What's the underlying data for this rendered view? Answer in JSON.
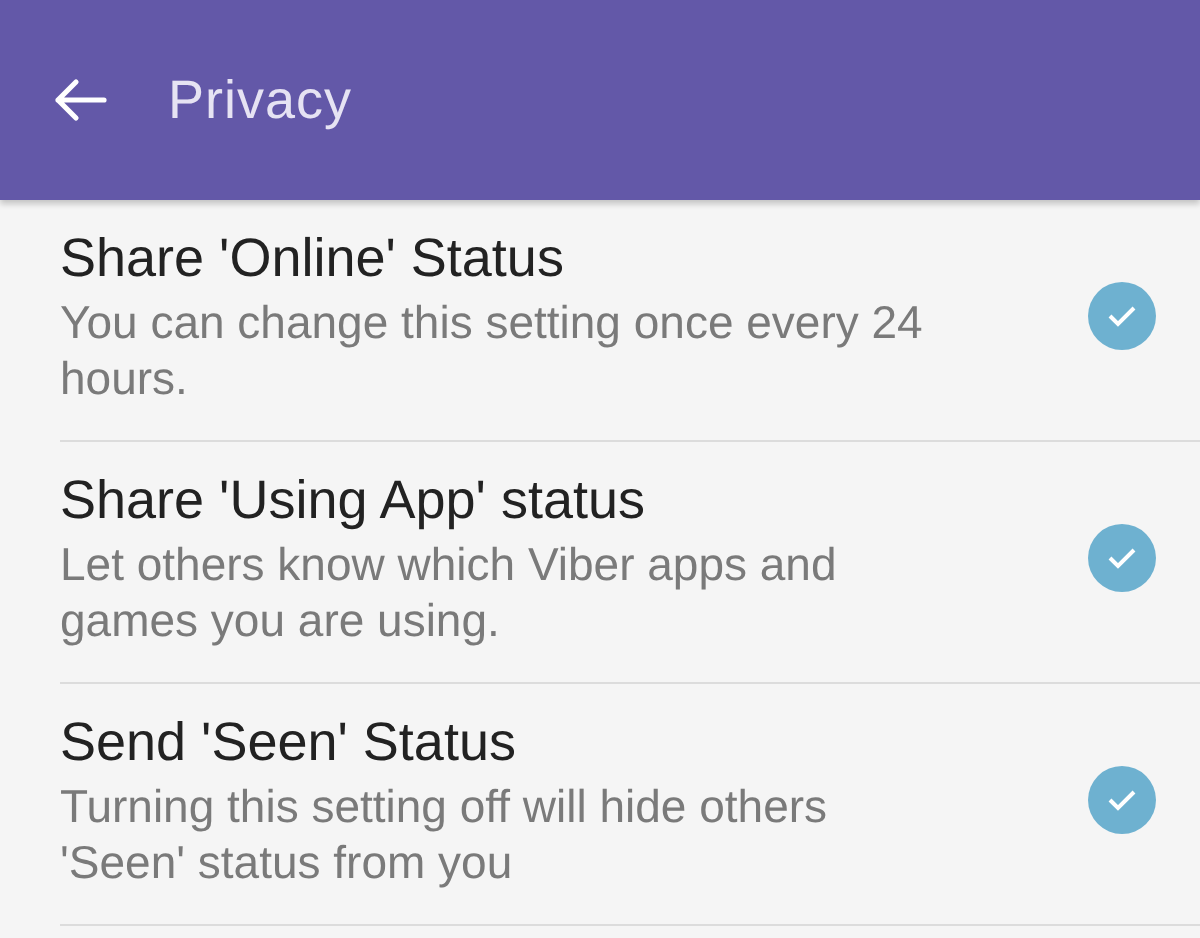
{
  "app_bar": {
    "title": "Privacy"
  },
  "settings": [
    {
      "title": "Share 'Online' Status",
      "description": "You can change this setting once every 24 hours.",
      "checked": true
    },
    {
      "title": "Share 'Using App' status",
      "description": "Let others know which Viber apps and games you are using.",
      "checked": true
    },
    {
      "title": "Send 'Seen' Status",
      "description": "Turning this setting off will hide others 'Seen' status from you",
      "checked": true
    }
  ]
}
